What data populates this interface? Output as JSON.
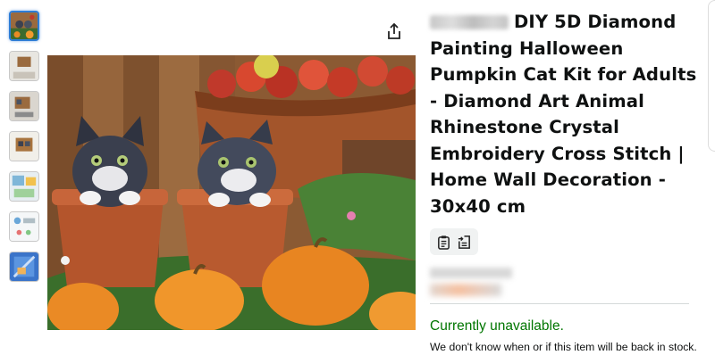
{
  "thumbnails": [
    {
      "name": "thumb-1",
      "active": true
    },
    {
      "name": "thumb-2",
      "active": false
    },
    {
      "name": "thumb-3",
      "active": false
    },
    {
      "name": "thumb-4",
      "active": false
    },
    {
      "name": "thumb-5",
      "active": false
    },
    {
      "name": "thumb-6",
      "active": false
    },
    {
      "name": "thumb-7",
      "active": false
    }
  ],
  "icons": {
    "share": "share-icon",
    "clipboard": "clipboard-icon",
    "compare": "compare-icon"
  },
  "product": {
    "title": "DIY 5D Diamond Painting Halloween Pumpkin Cat Kit for Adults - Diamond Art Animal Rhinestone Crystal Embroidery Cross Stitch | Home Wall Decoration - 30x40 cm"
  },
  "availability": {
    "status": "Currently unavailable.",
    "note": "We don't know when or if this item will be back in stock."
  },
  "colors": {
    "availability": "#007600",
    "thumb_active_border": "#2e7dd6",
    "text": "#0f1111"
  }
}
